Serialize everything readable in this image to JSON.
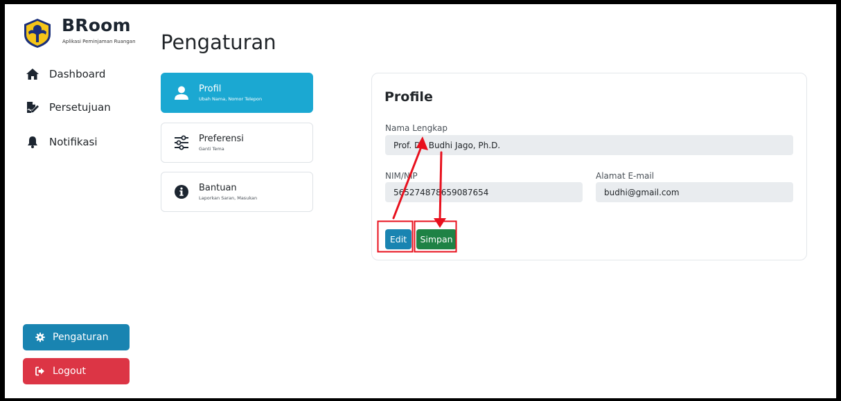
{
  "brand": {
    "name": "BRoom",
    "subtitle": "Aplikasi Peminjaman Ruangan"
  },
  "sidebar": {
    "items": [
      {
        "label": "Dashboard",
        "icon": "home-icon"
      },
      {
        "label": "Persetujuan",
        "icon": "signature-icon"
      },
      {
        "label": "Notifikasi",
        "icon": "bell-icon"
      }
    ],
    "settings_button": "Pengaturan",
    "logout_button": "Logout"
  },
  "page": {
    "title": "Pengaturan"
  },
  "settings_menu": [
    {
      "title": "Profil",
      "subtitle": "Ubah Nama, Nomor Telepon",
      "icon": "user-icon",
      "active": true
    },
    {
      "title": "Preferensi",
      "subtitle": "Ganti Tema",
      "icon": "sliders-icon",
      "active": false
    },
    {
      "title": "Bantuan",
      "subtitle": "Laporkan Saran, Masukan",
      "icon": "info-icon",
      "active": false
    }
  ],
  "profile": {
    "title": "Profile",
    "name_label": "Nama Lengkap",
    "name_value": "Prof. Dr. Budhi Jago, Ph.D.",
    "nim_label": "NIM/NIP",
    "nim_value": "565274878659087654",
    "email_label": "Alamat E-mail",
    "email_value": "budhi@gmail.com",
    "edit_button": "Edit",
    "save_button": "Simpan"
  },
  "colors": {
    "primary": "#1ba8d2",
    "edit": "#1984b1",
    "save": "#1e8245",
    "logout": "#dc3545",
    "annotation": "#e8101d"
  }
}
